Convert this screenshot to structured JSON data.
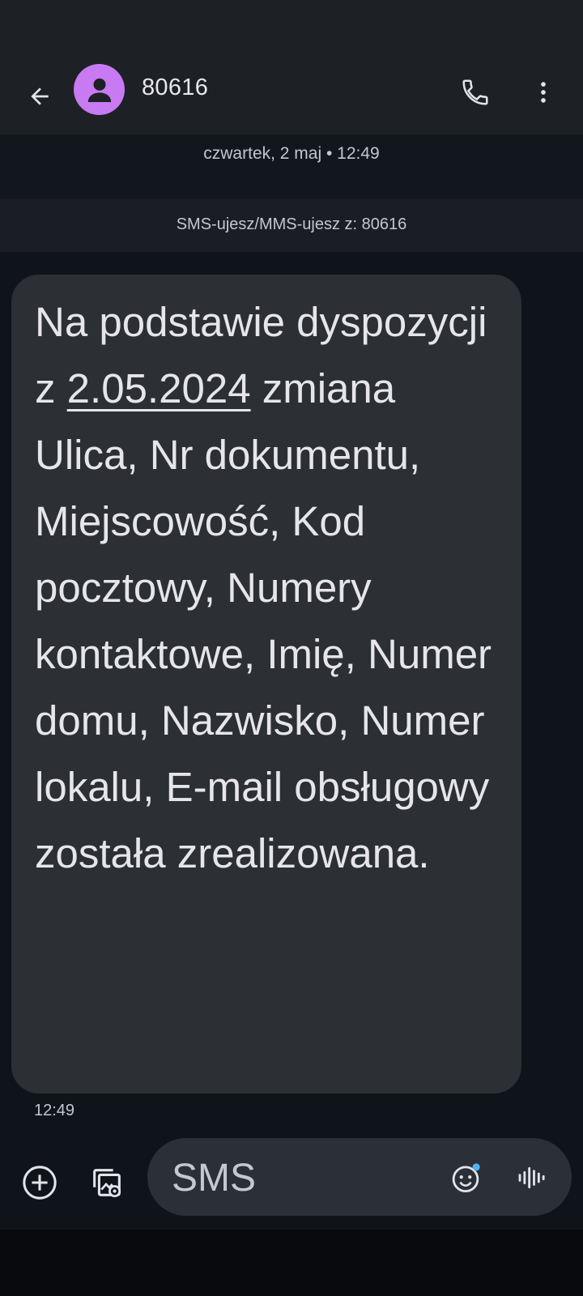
{
  "header": {
    "contact_name": "80616",
    "back_icon": "arrow-back-icon",
    "avatar_icon": "person-icon",
    "call_icon": "phone-icon",
    "more_icon": "more-vert-icon",
    "avatar_color": "#c87af2"
  },
  "conversation": {
    "date_separator": "czwartek, 2 maj • 12:49",
    "sms_banner": "SMS-ujesz/MMS-ujesz z: 80616",
    "message": {
      "text_before": "Na podstawie dyspozycji z ",
      "link": "2.05.2024",
      "text_after": " zmiana Ulica, Nr dokumentu, Miejscowość, Kod pocztowy, Numery kontaktowe, Imię, Numer domu, Nazwisko, Numer lokalu, E-mail obsługowy została zrealizowana.",
      "time": "12:49"
    }
  },
  "compose": {
    "placeholder": "SMS",
    "add_icon": "add-circle-icon",
    "gallery_icon": "gallery-icon",
    "emoji_icon": "emoji-icon",
    "voice_icon": "voice-wave-icon"
  }
}
